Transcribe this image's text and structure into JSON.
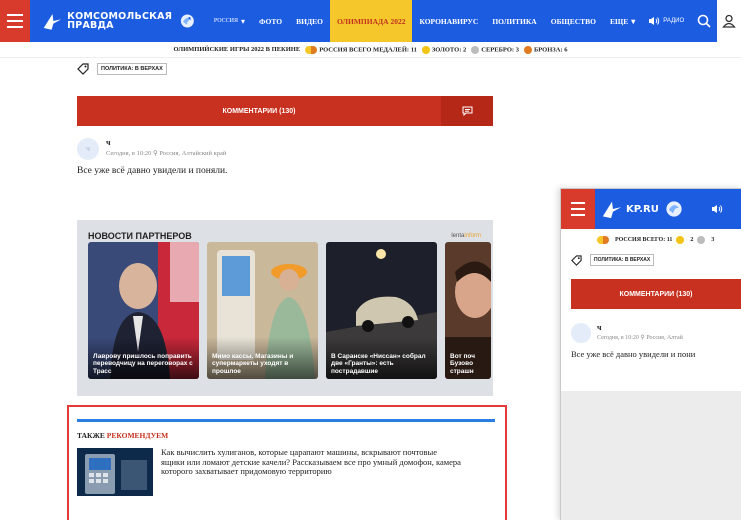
{
  "header": {
    "logo_line1": "Комсомольская",
    "logo_line2": "правда",
    "region": "РОССИЯ",
    "nav": [
      "ФОТО",
      "ВИДЕО",
      "ОЛИМПИАДА 2022",
      "КОРОНАВИРУС",
      "ПОЛИТИКА",
      "ОБЩЕСТВО"
    ],
    "more": "ЕЩЕ",
    "radio": "РАДИО",
    "colors": {
      "nav_bg": "#1c5ce0",
      "burger_bg": "#d83a2c",
      "active_bg": "#f6c72a"
    }
  },
  "olympics": {
    "title": "ОЛИМПИЙСКИЕ ИГРЫ 2022 В ПЕКИНЕ",
    "total": "РОССИЯ ВСЕГО МЕДАЛЕЙ: 11",
    "gold": "ЗОЛОТО: 2",
    "silver": "СЕРЕБРО: 3",
    "bronze": "БРОНЗА: 6"
  },
  "article": {
    "tag": "ПОЛИТИКА: В ВЕРХАХ",
    "comments_button": "КОММЕНТАРИИ (130)",
    "comment": {
      "avatar_letter": "ч",
      "author": "ч",
      "when": "Сегодня, в 10:20",
      "location": "Россия, Алтайский край",
      "text": "Все уже всё давно увидели и поняли."
    }
  },
  "partners": {
    "title": "НОВОСТИ ПАРТНЕРОВ",
    "source_a": "lenta",
    "source_b": "inform",
    "cards": [
      {
        "caption": "Лаврову пришлось поправить переводчицу на переговорах с Трасс"
      },
      {
        "caption": "Мимо кассы. Магазины и супермаркеты уходят в прошлое"
      },
      {
        "caption": "В Саранске «Ниссан» собрал две «Гранты»: есть пострадавшие"
      },
      {
        "caption": "Вот поч Бузово страшн"
      }
    ]
  },
  "recommend": {
    "title_a": "ТАКЖЕ ",
    "title_b": "РЕКОМЕНДУЕМ",
    "item_text": "Как вычислить хулиганов, которые царапают машины, вскрывают почтовые ящики или ломают детские качели? Рассказываем все про умный домофон, камера которого захватывает придомовую территорию"
  },
  "mobile": {
    "logo": "KP.RU",
    "olymp_total": "РОССИЯ ВСЕГО: 11",
    "gold": "2",
    "silver": "3",
    "tag": "ПОЛИТИКА: В ВЕРХАХ",
    "comments_button": "КОММЕНТАРИИ (130)",
    "author": "ч",
    "when": "Сегодня, в 10:20",
    "location": "Россия, Алтай",
    "text": "Все уже всё давно увидели и пони"
  }
}
